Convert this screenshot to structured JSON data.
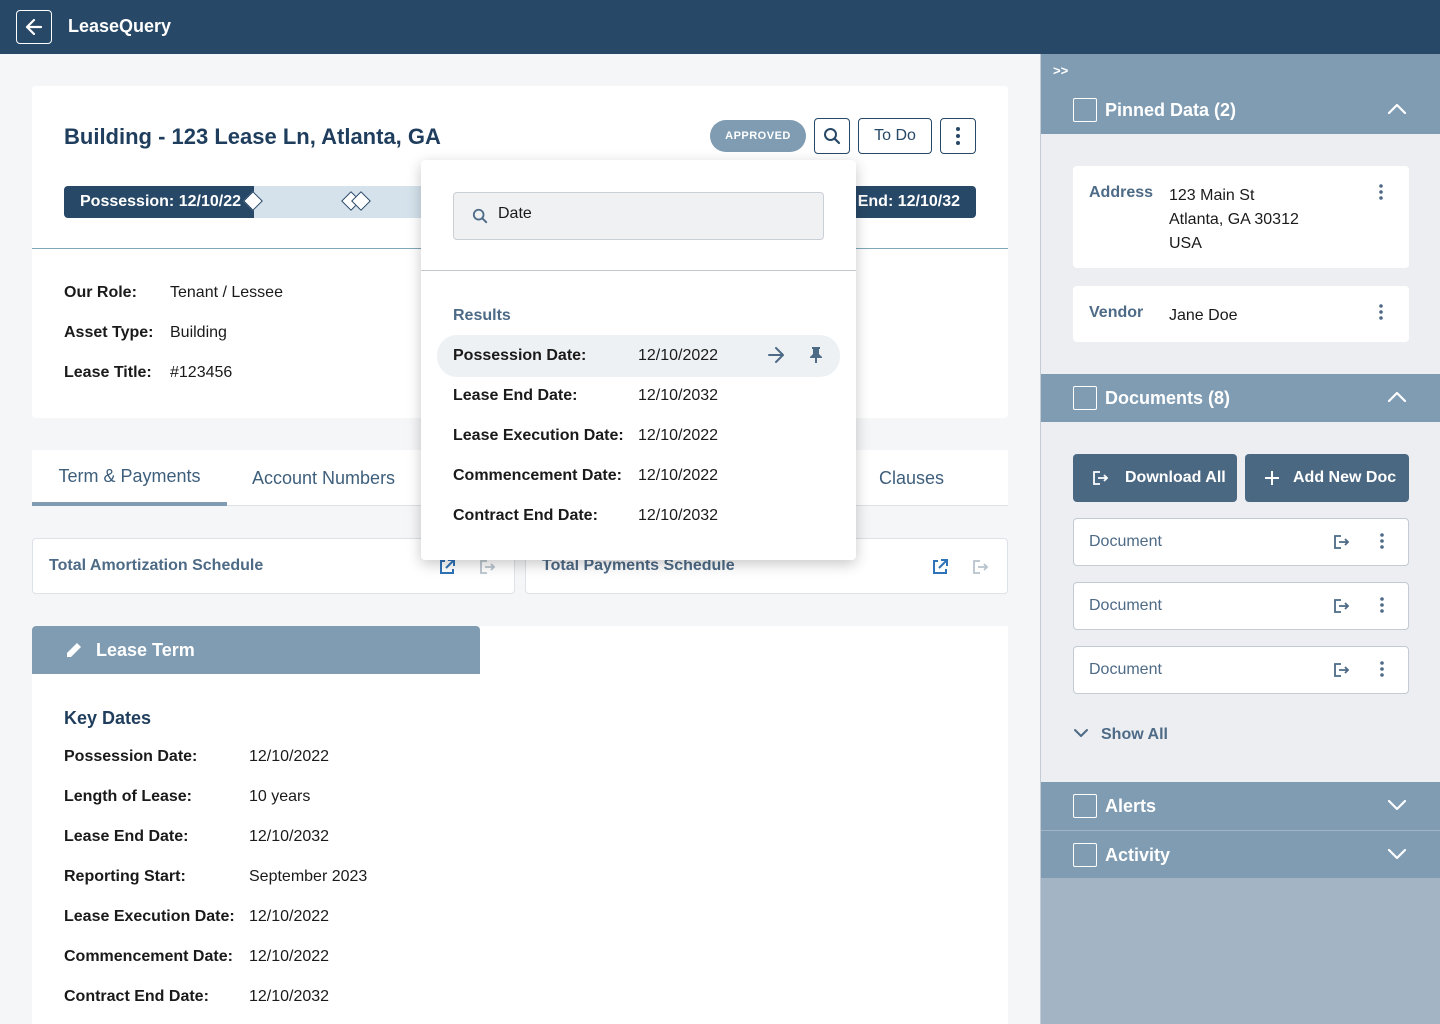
{
  "app": {
    "title": "LeaseQuery"
  },
  "header": {
    "title": "Building - 123 Lease Ln, Atlanta, GA",
    "status": "APPROVED",
    "todo_label": "To Do"
  },
  "timeline": {
    "start_label": "Possession: 12/10/22",
    "end_label": "End: 12/10/32"
  },
  "info": [
    {
      "label": "Our Role:",
      "value": "Tenant / Lessee"
    },
    {
      "label": "Asset Type:",
      "value": "Building"
    },
    {
      "label": "Lease Title:",
      "value": "#123456"
    }
  ],
  "tabs": [
    {
      "label": "Term & Payments",
      "active": true
    },
    {
      "label": "Account Numbers",
      "active": false
    },
    {
      "label": "Clauses",
      "active": false
    }
  ],
  "schedules": {
    "amortization": "Total Amortization Schedule",
    "payments": "Total Payments Schedule"
  },
  "lease_term": {
    "header": "Lease Term",
    "key_dates_title": "Key Dates",
    "rows": [
      {
        "label": "Possession Date:",
        "value": "12/10/2022"
      },
      {
        "label": "Length of Lease:",
        "value": "10 years"
      },
      {
        "label": "Lease End Date:",
        "value": "12/10/2032"
      },
      {
        "label": "Reporting Start:",
        "value": "September 2023"
      },
      {
        "label": "Lease Execution Date:",
        "value": "12/10/2022"
      },
      {
        "label": "Commencement Date:",
        "value": "12/10/2022"
      },
      {
        "label": "Contract End Date:",
        "value": "12/10/2032"
      }
    ]
  },
  "search": {
    "query": "Date",
    "results_title": "Results",
    "results": [
      {
        "label": "Possession Date:",
        "value": "12/10/2022",
        "highlighted": true
      },
      {
        "label": "Lease End Date:",
        "value": "12/10/2032",
        "highlighted": false
      },
      {
        "label": "Lease Execution Date:",
        "value": "12/10/2022",
        "highlighted": false
      },
      {
        "label": "Commencement Date:",
        "value": "12/10/2022",
        "highlighted": false
      },
      {
        "label": "Contract End Date:",
        "value": "12/10/2032",
        "highlighted": false
      }
    ]
  },
  "rpanel": {
    "collapse_label": ">>",
    "pinned": {
      "title": "Pinned Data (2)",
      "address_label": "Address",
      "address_line1": "123 Main St",
      "address_line2": "Atlanta, GA 30312",
      "address_line3": "USA",
      "vendor_label": "Vendor",
      "vendor_value": "Jane Doe"
    },
    "documents": {
      "title": "Documents (8)",
      "download_all": "Download All",
      "add_new": "Add New Doc",
      "items": [
        "Document",
        "Document",
        "Document"
      ],
      "show_all": "Show All"
    },
    "alerts_title": "Alerts",
    "activity_title": "Activity"
  },
  "colors": {
    "navy": "#274867",
    "steel": "#7f9cb3",
    "panel": "#a3b5c4"
  }
}
